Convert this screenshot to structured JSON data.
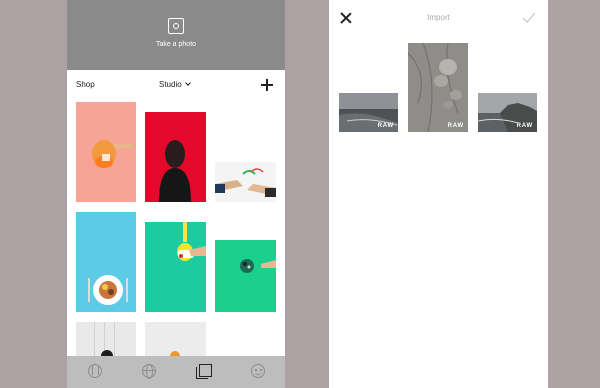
{
  "left_screen": {
    "camera": {
      "label": "Take a photo",
      "icon": "camera-frame-icon"
    },
    "toolbar": {
      "shop_label": "Shop",
      "studio_label": "Studio",
      "add_icon": "plus-icon"
    },
    "thumbnails": [
      {
        "subject": "orange drink on pink",
        "color": "#f7a395"
      },
      {
        "subject": "person on red",
        "color": "#e6082a"
      },
      {
        "subject": "hands on white",
        "color": "#f4f4f4"
      },
      {
        "subject": "food plate on blue",
        "color": "#5ccbe6"
      },
      {
        "subject": "yellow object on teal",
        "color": "#1dcba0"
      },
      {
        "subject": "hand with item on green",
        "color": "#1bd08d"
      },
      {
        "subject": "object on white",
        "color": "#e9e9e9"
      },
      {
        "subject": "orange object on light gray",
        "color": "#ececec"
      }
    ],
    "bottom_nav": [
      {
        "name": "bars",
        "icon": "bars-icon"
      },
      {
        "name": "explore",
        "icon": "globe-icon"
      },
      {
        "name": "library",
        "icon": "library-icon",
        "active": true
      },
      {
        "name": "profile",
        "icon": "face-icon"
      }
    ]
  },
  "right_screen": {
    "title": "Import",
    "close_icon": "close-icon",
    "confirm_icon": "checkmark-icon",
    "photos": [
      {
        "tag": "RAW",
        "subject": "coastal seascape"
      },
      {
        "tag": "RAW",
        "subject": "stones on ground"
      },
      {
        "tag": "RAW",
        "subject": "rocky shoreline"
      }
    ]
  },
  "colors": {
    "background": "#aca2a4",
    "camera_header": "#8a8a8a",
    "bottom_nav": "#bdbdbd"
  }
}
